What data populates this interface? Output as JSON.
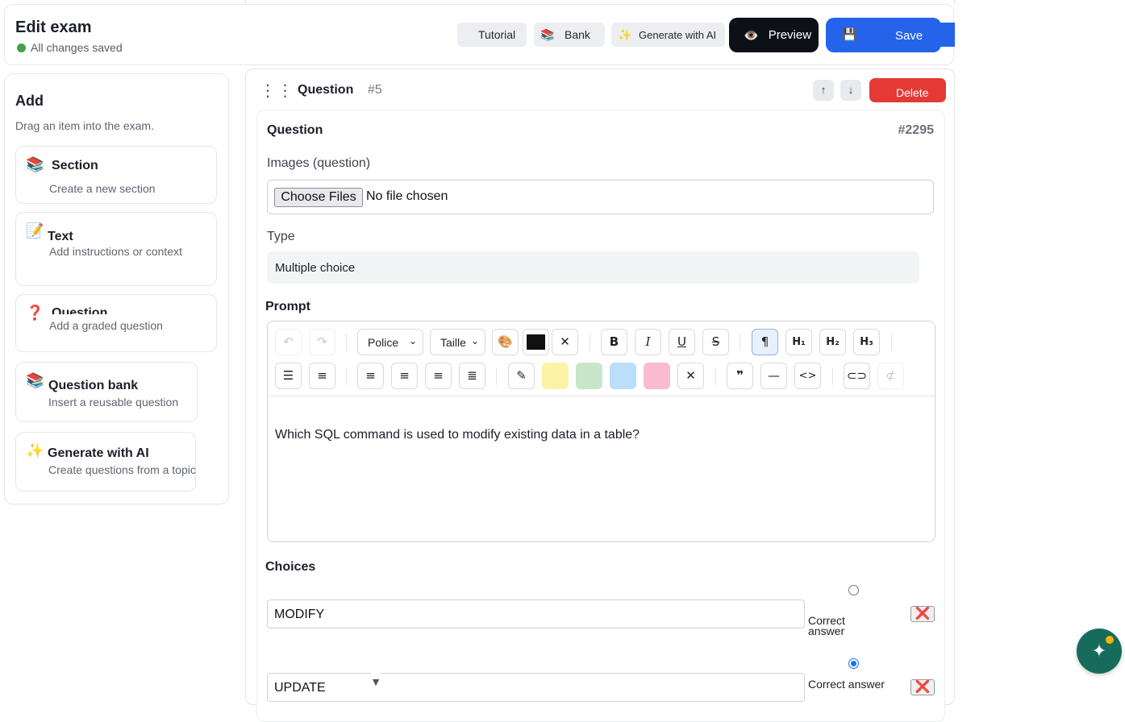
{
  "header": {
    "title": "Edit exam",
    "status": "All changes saved",
    "buttons": {
      "tutorial": "Tutorial",
      "bank": "Bank",
      "generate": "Generate with AI",
      "preview": "Preview",
      "save": "Save"
    },
    "icons": {
      "bank": "📚",
      "generate": "✨",
      "preview": "👁️",
      "save": "💾"
    }
  },
  "add_panel": {
    "title": "Add",
    "hint": "Drag an item into the exam.",
    "items": [
      {
        "icon": "📚",
        "title": "Section",
        "subtitle": "Create a new section"
      },
      {
        "icon": "📝",
        "title": "Text",
        "subtitle": "Add instructions or context"
      },
      {
        "icon": "❓",
        "title": "Question",
        "subtitle": "Add a graded question"
      },
      {
        "icon": "📚",
        "title": "Question bank",
        "subtitle": "Insert a reusable question"
      },
      {
        "icon": "✨",
        "title": "Generate with AI",
        "subtitle": "Create questions from a topic"
      }
    ]
  },
  "question": {
    "label": "Question",
    "number": "#5",
    "move_up": "↑",
    "move_down": "↓",
    "delete": "Delete",
    "inner_title": "Question",
    "inner_id": "#2295",
    "images_label": "Images (question)",
    "file_button": "Choose Files",
    "file_status": "No file chosen",
    "type_label": "Type",
    "type_value": "Multiple choice",
    "prompt_label": "Prompt",
    "editor": {
      "font_select": "Police",
      "size_select": "Taille",
      "text": "Which SQL command is used to modify existing data in a table?",
      "swatches": [
        "#fdf3a6",
        "#c8e6c9",
        "#bbdefb",
        "#f8bbd0"
      ],
      "text_color": "#111111"
    },
    "choices_label": "Choices",
    "choices": [
      {
        "text": "MODIFY",
        "correct": false,
        "correct_label": "Correct answer"
      },
      {
        "text": "UPDATE",
        "correct": true,
        "correct_label": "Correct answer"
      }
    ],
    "remove_icon": "❌"
  },
  "colors": {
    "save_blue": "#2563eb",
    "delete_red": "#e53935",
    "preview_black": "#0d1117",
    "assistant_green": "#176b5c"
  }
}
